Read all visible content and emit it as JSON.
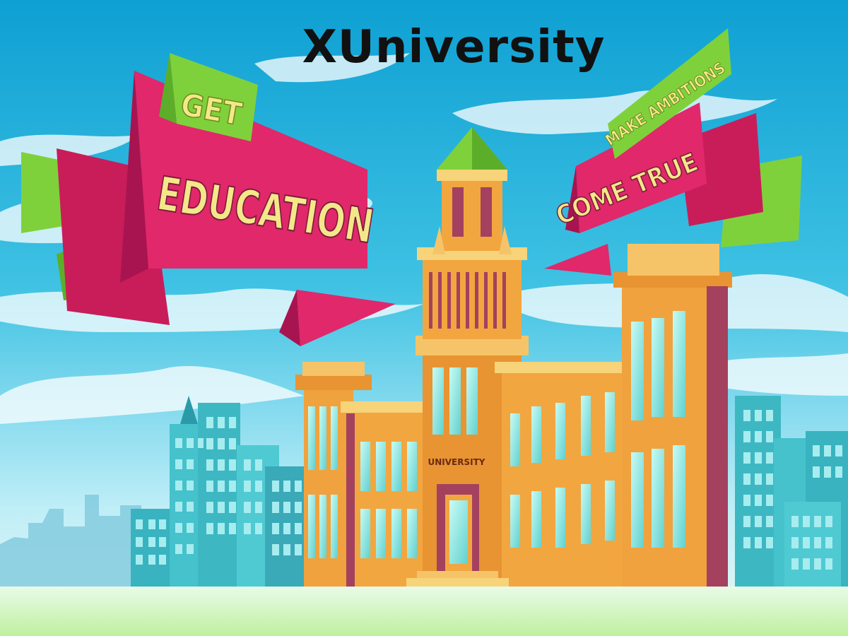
{
  "header": {
    "title": "XUniversity"
  },
  "banner_left": {
    "small": "GET",
    "big": "EDUCATION"
  },
  "banner_right": {
    "small": "MAKE AMBITIONS",
    "big": "COME TRUE"
  },
  "building": {
    "sign": "UNIVERSITY"
  },
  "colors": {
    "sky_top": "#12a6d6",
    "sky_bottom": "#e6f7fb",
    "ribbon": "#e0286a",
    "ribbon_dark": "#a81450",
    "green": "#7fd13b",
    "banner_text": "#f4e78a",
    "building_orange": "#f2a640",
    "building_purple": "#a3415f",
    "glass": "#9ce9e4",
    "teal_towers": "#3cb9c4",
    "ground": "#c7f0a3"
  }
}
